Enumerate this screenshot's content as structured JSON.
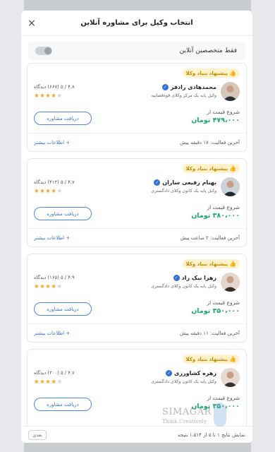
{
  "modal": {
    "title": "انتخاب وکیل برای مشاوره آنلاین",
    "close_icon": "×",
    "filter_label": "فقط متخصصین آنلاین"
  },
  "lawyers": [
    {
      "badge": "پیشنهاد بنیاد وکلا",
      "name": "محمدهادی رادفر",
      "title": "وکیل پایه یک مرکز وکلای قوه‌قضاییه",
      "rating_text": "۴.۸ / ۵  (۶۶۷) دیدگاه",
      "stars": 4,
      "price_label": "شروع قیمت از",
      "price_value": "۴۷۹،۰۰۰ تومان",
      "button": "دریافت مشاوره",
      "last_activity": "آخرین فعالیت: ۱۷ دقیقه پیش",
      "more": "+ اطلاعات بیشتر"
    },
    {
      "badge": "پیشنهاد بنیاد وکلا",
      "name": "بهنام رفیعی ساران",
      "title": "وکیل پایه یک کانون وکلای دادگستری",
      "rating_text": "۴.۷ / ۵  (۴۱۳) دیدگاه",
      "stars": 4,
      "price_label": "شروع قیمت از",
      "price_value": "۳۸۰،۰۰۰ تومان",
      "button": "دریافت مشاوره",
      "last_activity": "آخرین فعالیت: ۲ ساعت پیش",
      "more": "+ اطلاعات بیشتر"
    },
    {
      "badge": "پیشنهاد بنیاد وکلا",
      "name": "زهرا نیک زاد",
      "title": "وکیل پایه یک کانون وکلای دادگستری",
      "rating_text": "۴.۹ / ۵  (۱۶۵) دیدگاه",
      "stars": 4,
      "price_label": "شروع قیمت از",
      "price_value": "۳۵۰،۰۰۰ تومان",
      "button": "دریافت مشاوره",
      "last_activity": "آخرین فعالیت: ۱۱ دقیقه پیش",
      "more": "+ اطلاعات بیشتر"
    },
    {
      "badge": "پیشنهاد بنیاد وکلا",
      "name": "زهره کشاورزی",
      "title": "وکیل پایه یک کانون وکلای دادگستری",
      "rating_text": "۴.۷ / ۵  (۳۰۰) دیدگاه",
      "stars": 4,
      "price_label": "شروع قیمت از",
      "price_value": "۳۵۰،۰۰۰ تومان",
      "button": "دریافت مشاوره",
      "last_activity": "",
      "more": ""
    }
  ],
  "footer": {
    "results": "نمایش نتایج ۱ تا ۵ از ۱،۵۱۴ نتیجه",
    "next_button": "بعدی"
  },
  "watermark": {
    "text": "SIMAGAR",
    "sub": "Think Creatively"
  },
  "icons": {
    "badge": "thumbs-up-icon",
    "verified": "verified-check-icon",
    "star": "star-icon",
    "close": "close-icon"
  },
  "colors": {
    "accent_blue": "#3b72d4",
    "price_green": "#1aa86a",
    "star_gold": "#f5a623",
    "badge_bg": "#fff1c9"
  }
}
